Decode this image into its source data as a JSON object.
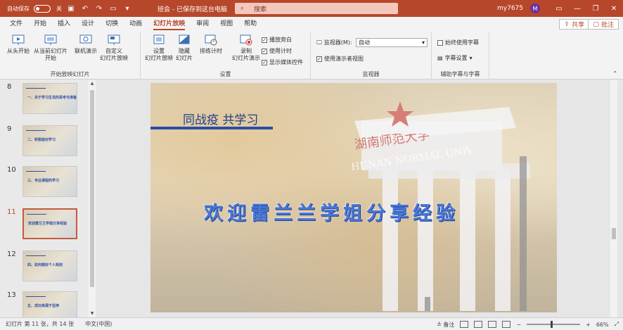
{
  "titlebar": {
    "autosave_label": "自动保存",
    "autosave_state": "关",
    "doc_title": "班会 - 已保存到这台电脑",
    "search_placeholder": "搜索",
    "username": "my7675",
    "avatar_initial": "M"
  },
  "tabs": [
    "文件",
    "开始",
    "插入",
    "设计",
    "切换",
    "动画",
    "幻灯片放映",
    "审阅",
    "视图",
    "帮助"
  ],
  "active_tab": "幻灯片放映",
  "share_label": "共享",
  "comments_label": "批注",
  "ribbon": {
    "start_group": {
      "label": "开始放映幻灯片",
      "from_beginning": "从头开始",
      "from_current_line1": "从当前幻灯片",
      "from_current_line2": "开始",
      "online_present": "联机演示",
      "custom_line1": "自定义",
      "custom_line2": "幻灯片放映"
    },
    "setup_group": {
      "label": "设置",
      "setup_line1": "设置",
      "setup_line2": "幻灯片放映",
      "hide_line1": "隐藏",
      "hide_line2": "幻灯片",
      "rehearse": "排练计时",
      "record_line1": "录制",
      "record_line2": "幻灯片演示",
      "chk_narration": "播放旁白",
      "chk_timings": "使用计时",
      "chk_media": "显示媒体控件"
    },
    "monitors_group": {
      "label": "监视器",
      "monitor_label": "监视器(M):",
      "monitor_value": "自动",
      "presenter_view": "使用演示者视图"
    },
    "captions_group": {
      "label": "辅助字幕与字幕",
      "always_subtitles": "始终使用字幕",
      "subtitle_settings": "字幕设置"
    }
  },
  "thumbnails": [
    {
      "num": "8",
      "title": "一、关于学习生活的思考与准备"
    },
    {
      "num": "9",
      "title": "二、积极面对学习"
    },
    {
      "num": "10",
      "title": "三、专业课程的学习"
    },
    {
      "num": "11",
      "title": "欢迎雷兰兰学姐分享经验"
    },
    {
      "num": "12",
      "title": "四、如何做好个人规划"
    },
    {
      "num": "13",
      "title": "五、成功来源于坚持"
    }
  ],
  "active_slide": "11",
  "slide": {
    "subtitle": "同战疫 共学习",
    "main_title": "欢迎雷兰兰学姐分享经验",
    "gate_text": "湖南师范大学",
    "gate_english": "HUNAN NORMAL UNIVERSITY"
  },
  "statusbar": {
    "slide_info": "幻灯片 第 11 张，共 14 张",
    "language": "中文(中国)",
    "notes": "备注",
    "zoom": "66%"
  }
}
